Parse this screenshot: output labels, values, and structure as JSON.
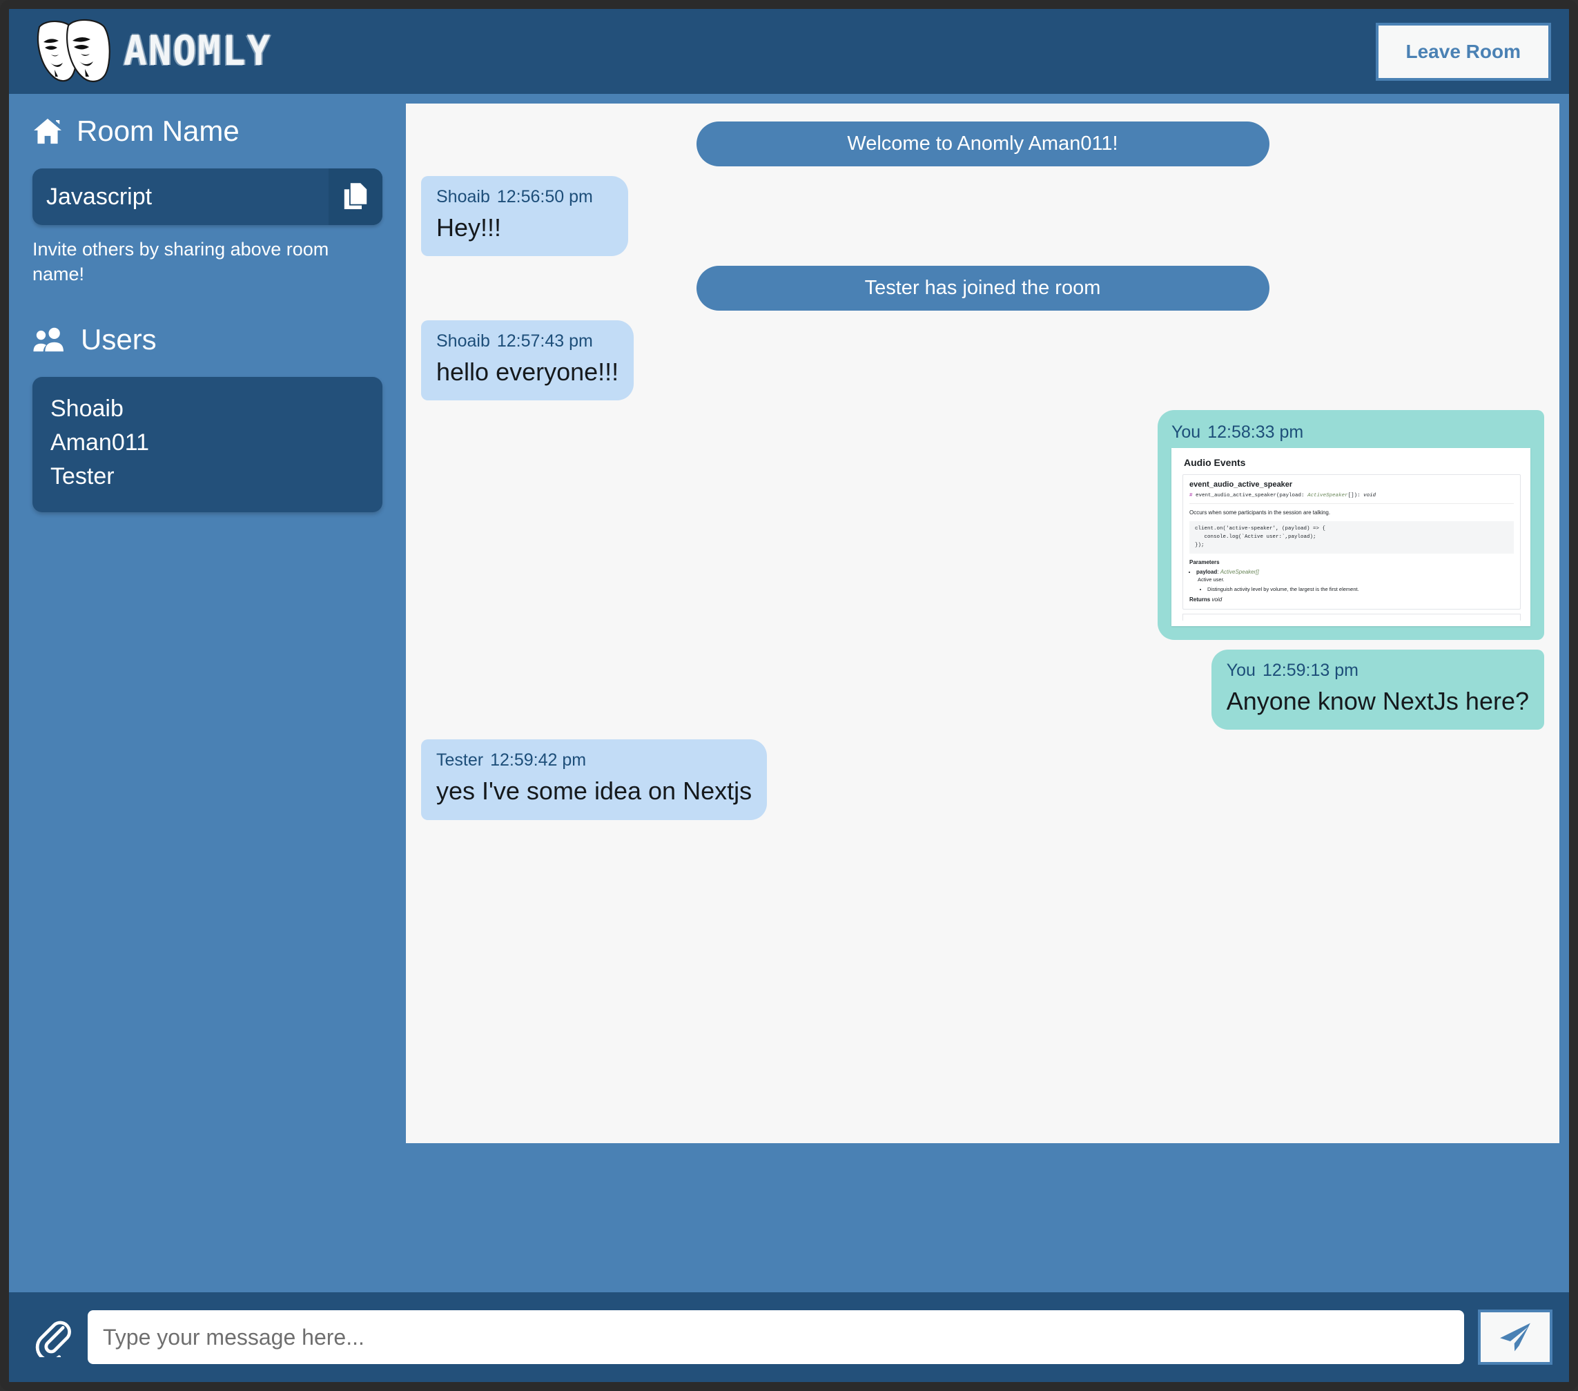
{
  "header": {
    "brand_name": "ANOMLY",
    "logo_icon": "guy-fawkes-masks-logo",
    "leave_room_label": "Leave Room"
  },
  "sidebar": {
    "room_name_heading": "Room Name",
    "room_name_icon": "home-icon",
    "room_name_value": "Javascript",
    "copy_icon": "copy-icon",
    "invite_note": "Invite others by sharing above room name!",
    "users_heading": "Users",
    "users_icon": "users-icon",
    "users": [
      "Shoaib",
      "Aman011",
      "Tester"
    ]
  },
  "chat": {
    "messages": [
      {
        "type": "system",
        "text": "Welcome to Anomly Aman011!"
      },
      {
        "type": "incoming",
        "who": "Shoaib",
        "time": "12:56:50 pm",
        "text": "Hey!!!"
      },
      {
        "type": "system",
        "text": "Tester has joined the room"
      },
      {
        "type": "incoming",
        "who": "Shoaib",
        "time": "12:57:43 pm",
        "text": "hello everyone!!!"
      },
      {
        "type": "outgoing-image",
        "who": "You",
        "time": "12:58:33 pm"
      },
      {
        "type": "outgoing",
        "who": "You",
        "time": "12:59:13 pm",
        "text": "Anyone know NextJs here?"
      },
      {
        "type": "incoming",
        "who": "Tester",
        "time": "12:59:42 pm",
        "text": "yes I've some idea on Nextjs"
      }
    ],
    "attached_image": {
      "title": "Audio Events",
      "section": "event_audio_active_speaker",
      "signature_hash": "#",
      "signature_name": "event_audio_active_speaker(payload:",
      "signature_type": "ActiveSpeaker",
      "signature_brackets": "[]):",
      "signature_return": "void",
      "description": "Occurs when some participants in the session are talking.",
      "code": "client.on('active-speaker', (payload) => {\n   console.log(`Active user:`,payload);\n});",
      "parameters_label": "Parameters",
      "param_name": "payload",
      "param_type": "ActiveSpeaker[]",
      "param_desc": "Active user.",
      "param_note": "Distinguish activity level by volume, the largest is the first element.",
      "returns_label": "Returns",
      "returns_value": "void"
    }
  },
  "composer": {
    "attach_icon": "paperclip-icon",
    "placeholder": "Type your message here...",
    "value": "",
    "send_icon": "paper-plane-icon"
  },
  "colors": {
    "header_navy": "#23507a",
    "sidebar_blue": "#4a81b4",
    "chat_bg": "#f7f7f7",
    "incoming_bubble": "#c2dcf6",
    "outgoing_bubble": "#98dcd6",
    "meta_text": "#1d4e79"
  }
}
